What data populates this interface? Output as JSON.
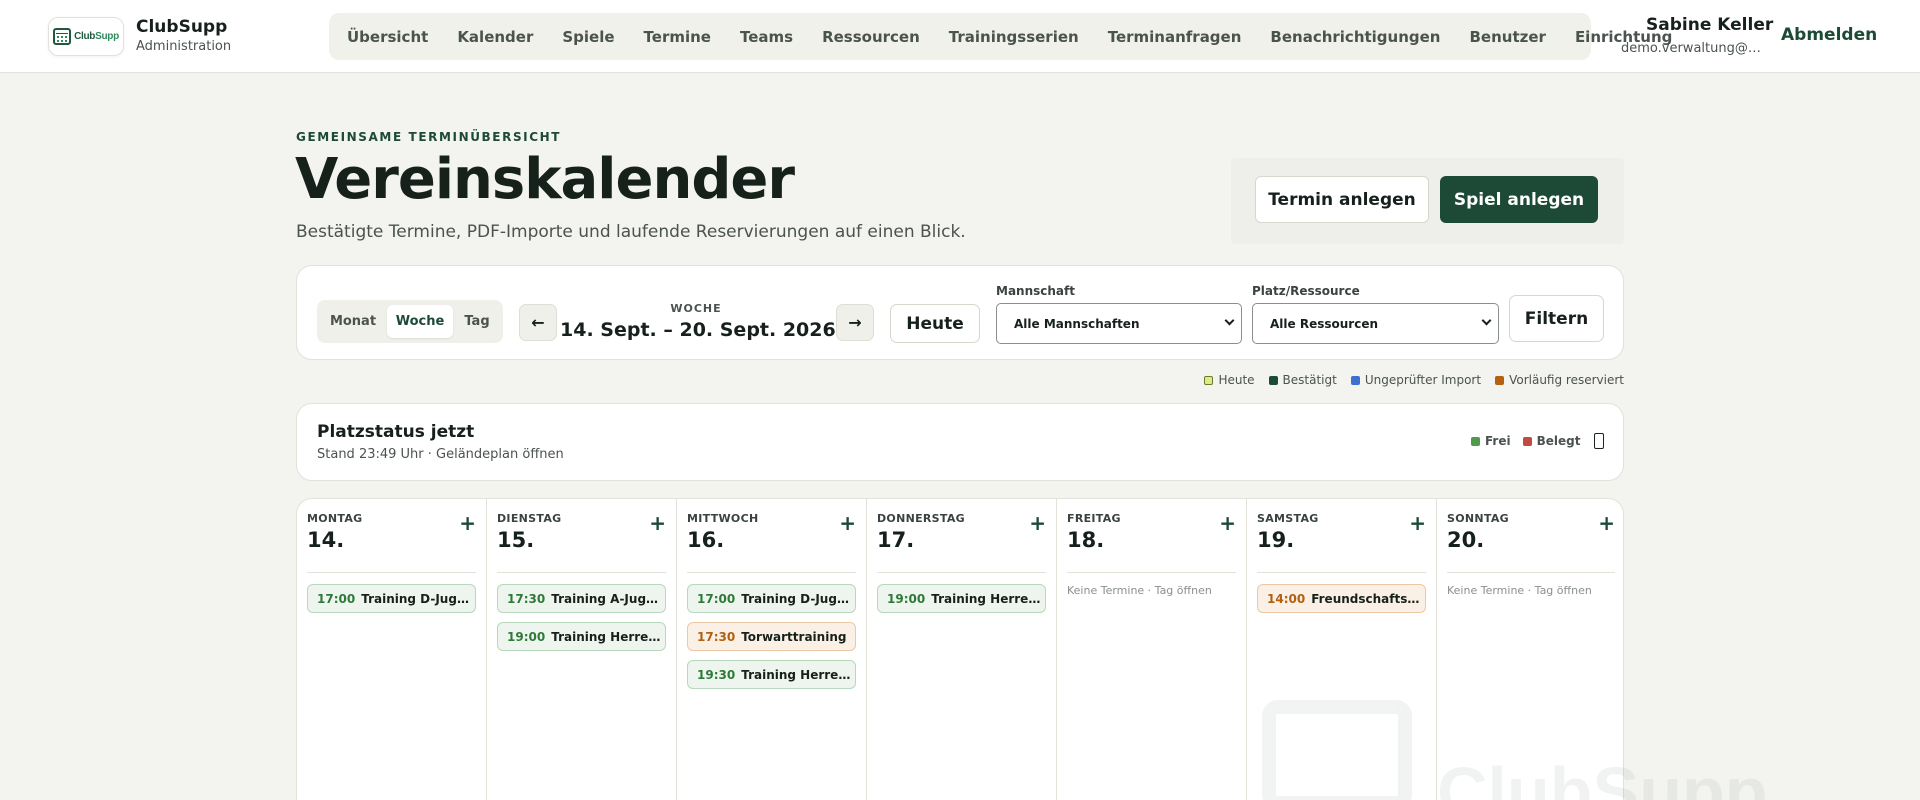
{
  "brand": {
    "logo_text_1": "Club",
    "logo_text_2": "Supp",
    "name": "ClubSupp",
    "subtitle": "Administration"
  },
  "nav": [
    "Übersicht",
    "Kalender",
    "Spiele",
    "Termine",
    "Teams",
    "Ressourcen",
    "Trainingsserien",
    "Terminanfragen",
    "Benachrichtigungen",
    "Benutzer",
    "Einrichtung"
  ],
  "user": {
    "name": "Sabine Keller",
    "email": "demo.verwaltung@c...",
    "logout": "Abmelden"
  },
  "header": {
    "eyebrow": "GEMEINSAME TERMINÜBERSICHT",
    "title": "Vereinskalender",
    "subtitle": "Bestätigte Termine, PDF-Importe und laufende Reservierungen auf einen Blick.",
    "btn_create_event": "Termin anlegen",
    "btn_create_game": "Spiel anlegen"
  },
  "toolbar": {
    "views": [
      "Monat",
      "Woche",
      "Tag"
    ],
    "active_view": "Woche",
    "prev": "←",
    "next": "→",
    "range_label": "WOCHE",
    "range": "14. Sept. – 20. Sept. 2026",
    "today": "Heute",
    "team_label": "Mannschaft",
    "team_value": "Alle Mannschaften",
    "resource_label": "Platz/Ressource",
    "resource_value": "Alle Ressourcen",
    "filter": "Filtern"
  },
  "legend": [
    {
      "label": "Heute",
      "color": "#dfe88a",
      "border": "#6d7a2a"
    },
    {
      "label": "Bestätigt",
      "color": "#1d4a36",
      "border": "#1d4a36"
    },
    {
      "label": "Ungeprüfter Import",
      "color": "#3f6fd1",
      "border": "#3f6fd1"
    },
    {
      "label": "Vorläufig reserviert",
      "color": "#b4600f",
      "border": "#b4600f"
    }
  ],
  "status": {
    "title": "Platzstatus jetzt",
    "subtitle": "Stand 23:49 Uhr · Geländeplan öffnen",
    "free_label": "Frei",
    "free_color": "#4f9a4c",
    "busy_label": "Belegt",
    "busy_color": "#c24a3f"
  },
  "days": [
    {
      "name": "MONTAG",
      "num": "14.",
      "events": [
        {
          "time": "17:00",
          "title": "Training D-Jugend",
          "type": "green"
        }
      ]
    },
    {
      "name": "DIENSTAG",
      "num": "15.",
      "events": [
        {
          "time": "17:30",
          "title": "Training A-Jugend",
          "type": "green"
        },
        {
          "time": "19:00",
          "title": "Training Herren I",
          "type": "green"
        }
      ]
    },
    {
      "name": "MITTWOCH",
      "num": "16.",
      "events": [
        {
          "time": "17:00",
          "title": "Training D-Jugend",
          "type": "green"
        },
        {
          "time": "17:30",
          "title": "Torwarttraining",
          "type": "orange"
        },
        {
          "time": "19:30",
          "title": "Training Herren II",
          "type": "green"
        }
      ]
    },
    {
      "name": "DONNERSTAG",
      "num": "17.",
      "events": [
        {
          "time": "19:00",
          "title": "Training Herren I",
          "type": "green"
        }
      ]
    },
    {
      "name": "FREITAG",
      "num": "18.",
      "events": [],
      "empty": "Keine Termine · Tag öffnen"
    },
    {
      "name": "SAMSTAG",
      "num": "19.",
      "events": [
        {
          "time": "14:00",
          "title": "Freundschaftsspiel",
          "type": "orange"
        }
      ]
    },
    {
      "name": "SONNTAG",
      "num": "20.",
      "events": [],
      "empty": "Keine Termine · Tag öffnen"
    }
  ]
}
